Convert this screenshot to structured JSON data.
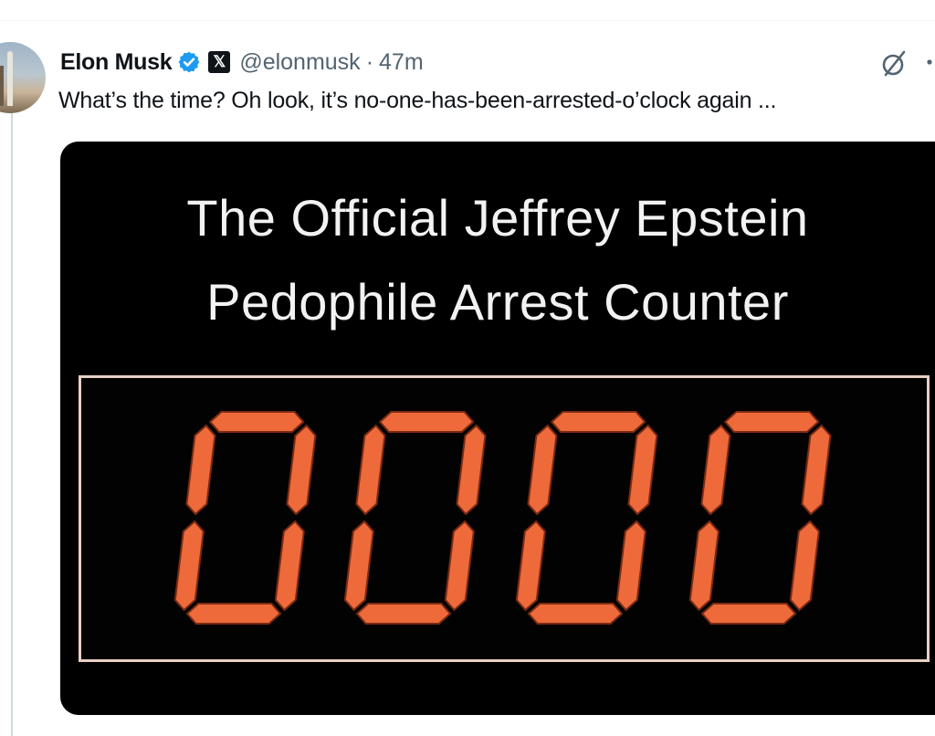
{
  "tweet": {
    "author_name": "Elon Musk",
    "handle": "@elonmusk",
    "separator": "·",
    "timestamp": "47m",
    "affiliate_badge": "𝕏",
    "text": "What’s the time? Oh look, it’s no-one-has-been-arrested-o’clock again ...",
    "verified_color": "#1d9bf0"
  },
  "media": {
    "title_line1": "The Official Jeffrey Epstein",
    "title_line2": "Pedophile Arrest Counter",
    "counter_value": "0000",
    "digit_color": "#ee6a3a"
  },
  "icons": [
    "verified-badge-icon",
    "x-logo-icon",
    "grok-icon",
    "more-icon"
  ]
}
